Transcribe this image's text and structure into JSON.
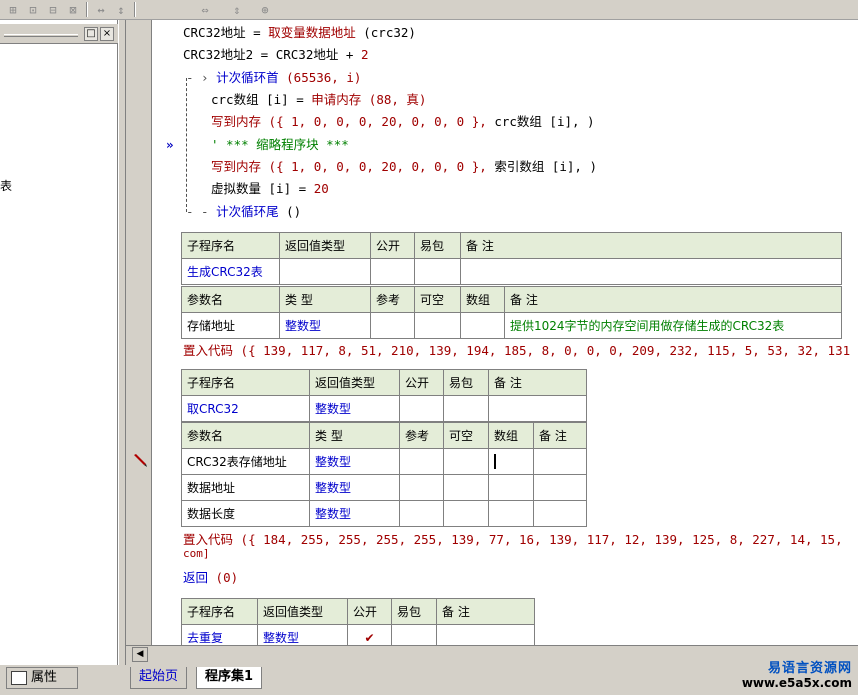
{
  "toolbar": {
    "icons": [
      "align-left-icon",
      "align-top-icon",
      "align-center-icon",
      "align-middle-icon",
      "space-horizontal-icon",
      "space-vertical-icon",
      "same-width-icon",
      "same-height-icon",
      "same-size-icon"
    ]
  },
  "left_panel": {
    "pin_label": "□",
    "close_label": "×",
    "peek_text": "表"
  },
  "code": {
    "l1": {
      "var": "CRC32地址",
      "op": " = ",
      "fn": "取变量数据地址",
      "args": " (crc32)"
    },
    "l2": {
      "var": "CRC32地址2",
      "op": " = ",
      "rhs": "CRC32地址",
      "plus": " + ",
      "num": "2"
    },
    "l3": {
      "kw": "计次循环首",
      "args": " (65536, i)"
    },
    "l4": {
      "var": "crc数组 [i]",
      "op": " = ",
      "fn": "申请内存",
      "args": " (88, 真)"
    },
    "l5": {
      "fn": "写到内存",
      "args": " ({ 1, 0, 0, 0, 20, 0, 0, 0 }, ",
      "tail": "crc数组 [i], )"
    },
    "l6": {
      "cmt": "' *** 缩略程序块 ***"
    },
    "l7": {
      "fn": "写到内存",
      "args": " ({ 1, 0, 0, 0, 20, 0, 0, 0 }, ",
      "tail": "索引数组 [i], )"
    },
    "l8": {
      "var": "虚拟数量 [i]",
      "op": " = ",
      "num": "20"
    },
    "l9": {
      "kw": "计次循环尾",
      "args": " ()"
    }
  },
  "sub1": {
    "hdr": [
      "子程序名",
      "返回值类型",
      "公开",
      "易包",
      "备 注"
    ],
    "name": "生成CRC32表",
    "phdr": [
      "参数名",
      "类 型",
      "参考",
      "可空",
      "数组",
      "备 注"
    ],
    "param_name": "存储地址",
    "param_type": "整数型",
    "param_note": "提供1024字节的内存空间用做存储生成的CRC32表",
    "embed_kw": "置入代码",
    "embed_args": " ({ 139, 117, 8, 51, 210, 139, 194, 185, 8, 0, 0, 0, 209, 232, 115, 5, 53, 32, 131"
  },
  "sub2": {
    "hdr": [
      "子程序名",
      "返回值类型",
      "公开",
      "易包",
      "备 注"
    ],
    "name": "取CRC32",
    "ret_type": "整数型",
    "phdr": [
      "参数名",
      "类 型",
      "参考",
      "可空",
      "数组",
      "备 注"
    ],
    "params": [
      {
        "name": "CRC32表存储地址",
        "type": "整数型"
      },
      {
        "name": "数据地址",
        "type": "整数型"
      },
      {
        "name": "数据长度",
        "type": "整数型"
      }
    ],
    "embed_kw": "置入代码",
    "embed_args": " ({ 184, 255, 255, 255, 255, 139, 77, 16, 139, 117, 12, 139, 125, 8, 227, 14, 15,",
    "embed_cont": "com]",
    "return_kw": "返回",
    "return_args": " (0)"
  },
  "sub3": {
    "hdr": [
      "子程序名",
      "返回值类型",
      "公开",
      "易包",
      "备 注"
    ],
    "name": "去重复",
    "ret_type": "整数型",
    "public_check": "✔"
  },
  "bottom": {
    "prop_label": "属性",
    "tab1": "起始页",
    "tab2": "程序集1",
    "wm_line1": "易语言资源网",
    "wm_line2": "www.e5a5x.com"
  },
  "colors": {
    "keyword": "#a00000",
    "type": "#0000cc",
    "comment": "#008000",
    "header_bg": "#e4edd8"
  }
}
